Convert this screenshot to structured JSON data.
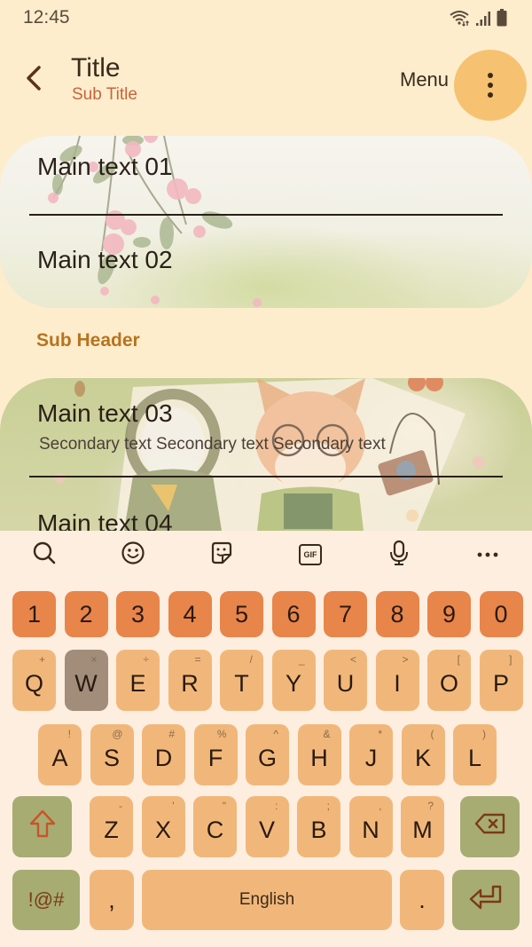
{
  "status_bar": {
    "time": "12:45",
    "icons": [
      "wifi-icon",
      "signal-icon",
      "battery-icon"
    ]
  },
  "app_bar": {
    "back_icon": "chevron-left-icon",
    "title": "Title",
    "subtitle": "Sub Title",
    "menu_label": "Menu",
    "more_icon": "more-vertical-icon"
  },
  "list_group_1": {
    "items": [
      {
        "main": "Main text 01"
      },
      {
        "main": "Main text 02"
      }
    ]
  },
  "sub_header": "Sub Header",
  "list_group_2": {
    "items": [
      {
        "main": "Main text 03",
        "secondary": "Secondary text Secondary text Secondary text"
      },
      {
        "main": "Main text 04"
      }
    ]
  },
  "keyboard": {
    "toolbar": [
      "search-icon",
      "emoji-icon",
      "sticker-icon",
      "gif-icon",
      "microphone-icon",
      "more-horizontal-icon"
    ],
    "gif_label": "GIF",
    "number_row": [
      "1",
      "2",
      "3",
      "4",
      "5",
      "6",
      "7",
      "8",
      "9",
      "0"
    ],
    "row1": [
      {
        "key": "Q",
        "sub": "+"
      },
      {
        "key": "W",
        "sub": "×"
      },
      {
        "key": "E",
        "sub": "÷"
      },
      {
        "key": "R",
        "sub": "="
      },
      {
        "key": "T",
        "sub": "/"
      },
      {
        "key": "Y",
        "sub": "_"
      },
      {
        "key": "U",
        "sub": "<"
      },
      {
        "key": "I",
        "sub": ">"
      },
      {
        "key": "O",
        "sub": "["
      },
      {
        "key": "P",
        "sub": "]"
      }
    ],
    "row2": [
      {
        "key": "A",
        "sub": "!"
      },
      {
        "key": "S",
        "sub": "@"
      },
      {
        "key": "D",
        "sub": "#"
      },
      {
        "key": "F",
        "sub": "%"
      },
      {
        "key": "G",
        "sub": "^"
      },
      {
        "key": "H",
        "sub": "&"
      },
      {
        "key": "J",
        "sub": "*"
      },
      {
        "key": "K",
        "sub": "("
      },
      {
        "key": "L",
        "sub": ")"
      }
    ],
    "row3": [
      {
        "key": "Z",
        "sub": "-"
      },
      {
        "key": "X",
        "sub": "'"
      },
      {
        "key": "C",
        "sub": "\""
      },
      {
        "key": "V",
        "sub": ":"
      },
      {
        "key": "B",
        "sub": ";"
      },
      {
        "key": "N",
        "sub": ","
      },
      {
        "key": "M",
        "sub": "?"
      }
    ],
    "pressed_key": "W",
    "symbols_label": "!@#",
    "comma": ",",
    "space_label": "English",
    "period": ".",
    "shift_icon": "shift-icon",
    "backspace_icon": "backspace-icon",
    "enter_icon": "enter-icon"
  },
  "colors": {
    "background": "#fdedcd",
    "accent_orange": "#e8854a",
    "key": "#f1b77a",
    "func_key": "#a7ac72",
    "subtitle": "#c8643a",
    "sub_header": "#b8731e",
    "more_button": "#f6c271"
  }
}
